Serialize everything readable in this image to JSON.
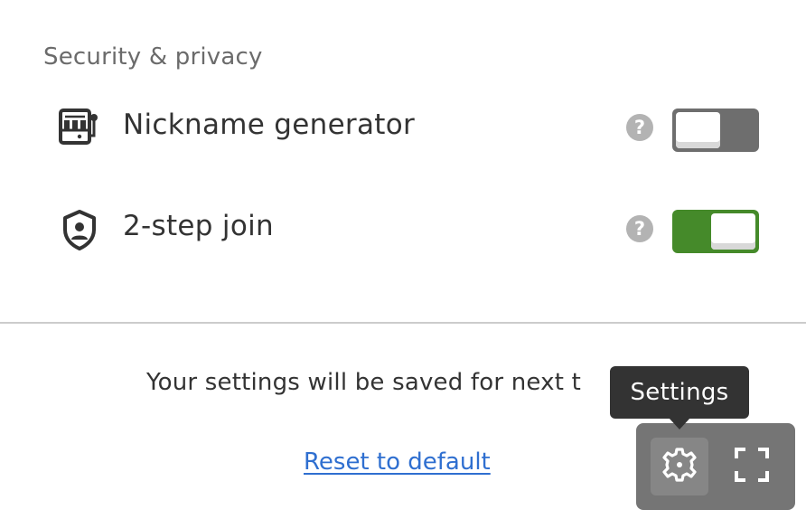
{
  "section": {
    "title": "Security & privacy"
  },
  "settings": [
    {
      "icon": "slot-machine-icon",
      "label": "Nickname generator",
      "help": "?",
      "enabled": false
    },
    {
      "icon": "shield-user-icon",
      "label": "2-step join",
      "help": "?",
      "enabled": true
    }
  ],
  "footer": {
    "save_note": "Your settings will be saved for next t",
    "reset_label": "Reset to default"
  },
  "controls": {
    "settings_icon": "gear-icon",
    "fullscreen_icon": "fullscreen-icon",
    "tooltip": "Settings"
  },
  "colors": {
    "toggle_on": "#458a2a",
    "toggle_off": "#6e6e6e",
    "link": "#2f6fd0",
    "tooltip_bg": "#333333"
  }
}
